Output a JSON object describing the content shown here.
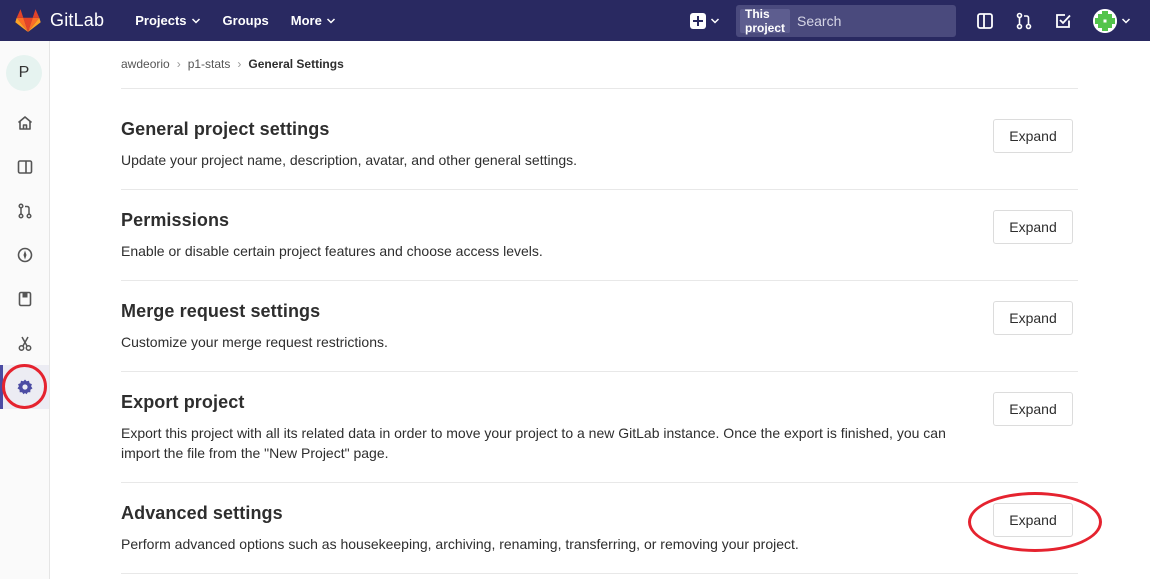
{
  "navbar": {
    "brand": "GitLab",
    "links": [
      {
        "label": "Projects",
        "dropdown": true
      },
      {
        "label": "Groups",
        "dropdown": false
      },
      {
        "label": "More",
        "dropdown": true
      }
    ],
    "search_scope": "This project",
    "search_placeholder": "Search",
    "icons": [
      "plus-icon",
      "sidebar-toggle-icon",
      "merge-request-icon",
      "todo-check-icon",
      "user-avatar"
    ]
  },
  "sidebar": {
    "project_initial": "P",
    "items": [
      {
        "icon": "home-icon",
        "active": false
      },
      {
        "icon": "issues-icon",
        "active": false
      },
      {
        "icon": "merge-request-icon",
        "active": false
      },
      {
        "icon": "ci-cd-icon",
        "active": false
      },
      {
        "icon": "wiki-icon",
        "active": false
      },
      {
        "icon": "snippets-icon",
        "active": false
      },
      {
        "icon": "settings-icon",
        "active": true
      }
    ]
  },
  "breadcrumb": {
    "items": [
      "awdeorio",
      "p1-stats"
    ],
    "current": "General Settings"
  },
  "sections": [
    {
      "title": "General project settings",
      "description": "Update your project name, description, avatar, and other general settings.",
      "button": "Expand"
    },
    {
      "title": "Permissions",
      "description": "Enable or disable certain project features and choose access levels.",
      "button": "Expand"
    },
    {
      "title": "Merge request settings",
      "description": "Customize your merge request restrictions.",
      "button": "Expand"
    },
    {
      "title": "Export project",
      "description": "Export this project with all its related data in order to move your project to a new GitLab instance. Once the export is finished, you can import the file from the \"New Project\" page.",
      "button": "Expand"
    },
    {
      "title": "Advanced settings",
      "description": "Perform advanced options such as housekeeping, archiving, renaming, transferring, or removing your project.",
      "button": "Expand"
    }
  ],
  "colors": {
    "navbar": "#292961",
    "annotation": "#e5232f",
    "sidebar_active": "#4b4ba3"
  }
}
